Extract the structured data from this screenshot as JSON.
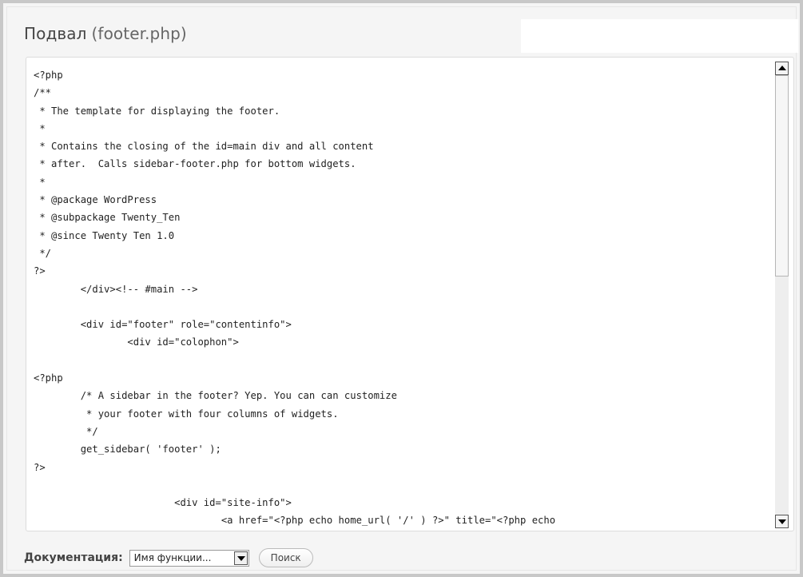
{
  "header": {
    "title": "Подвал",
    "filename": "(footer.php)"
  },
  "editor": {
    "code": "<?php\n/**\n * The template for displaying the footer.\n *\n * Contains the closing of the id=main div and all content\n * after.  Calls sidebar-footer.php for bottom widgets.\n *\n * @package WordPress\n * @subpackage Twenty_Ten\n * @since Twenty Ten 1.0\n */\n?>\n\t</div><!-- #main -->\n\n\t<div id=\"footer\" role=\"contentinfo\">\n\t\t<div id=\"colophon\">\n\n<?php\n\t/* A sidebar in the footer? Yep. You can can customize\n\t * your footer with four columns of widgets.\n\t */\n\tget_sidebar( 'footer' );\n?>\n\n\t\t\t<div id=\"site-info\">\n\t\t\t\t<a href=\"<?php echo home_url( '/' ) ?>\" title=\"<?php echo"
  },
  "documentation": {
    "label": "Документация:",
    "select_value": "Имя функции...",
    "search_button": "Поиск"
  }
}
